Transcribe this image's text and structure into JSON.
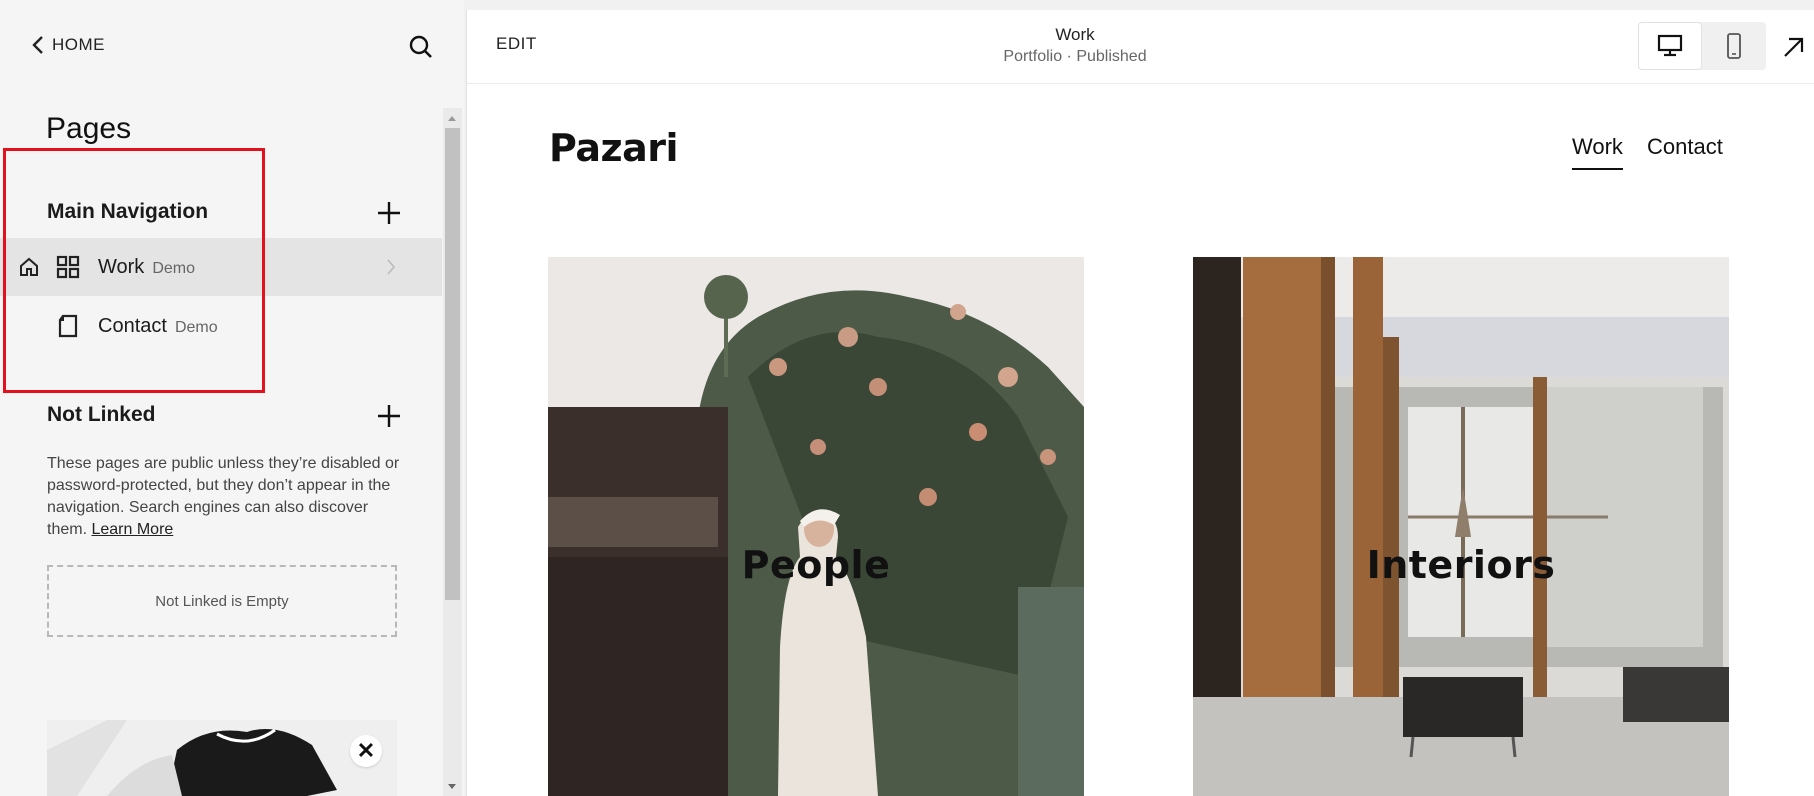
{
  "sidebar": {
    "home_label": "HOME",
    "title": "Pages",
    "main_navigation": {
      "title": "Main Navigation",
      "items": [
        {
          "label": "Work",
          "tag": "Demo",
          "icon": "grid-icon",
          "is_home": true,
          "active": true
        },
        {
          "label": "Contact",
          "tag": "Demo",
          "icon": "page-icon",
          "is_home": false,
          "active": false
        }
      ]
    },
    "not_linked": {
      "title": "Not Linked",
      "description": "These pages are public unless they’re disabled or password-protected, but they don’t appear in the navigation. Search engines can also discover them.",
      "learn_more": "Learn More",
      "empty_text": "Not Linked is Empty"
    },
    "promo_close": "✕"
  },
  "preview": {
    "edit_label": "EDIT",
    "page_name": "Work",
    "page_status": "Portfolio · Published",
    "device_modes": [
      "desktop-icon",
      "mobile-icon"
    ],
    "selected_device": "desktop"
  },
  "site": {
    "title": "Pazari",
    "nav": [
      {
        "label": "Work",
        "active": true
      },
      {
        "label": "Contact",
        "active": false
      }
    ],
    "tiles": [
      {
        "label": "People"
      },
      {
        "label": "Interiors"
      }
    ]
  },
  "colors": {
    "highlight": "#e3111b",
    "sidebar_bg": "#f5f5f5",
    "active_row": "#e4e4e4",
    "text": "#1a1a1a"
  }
}
